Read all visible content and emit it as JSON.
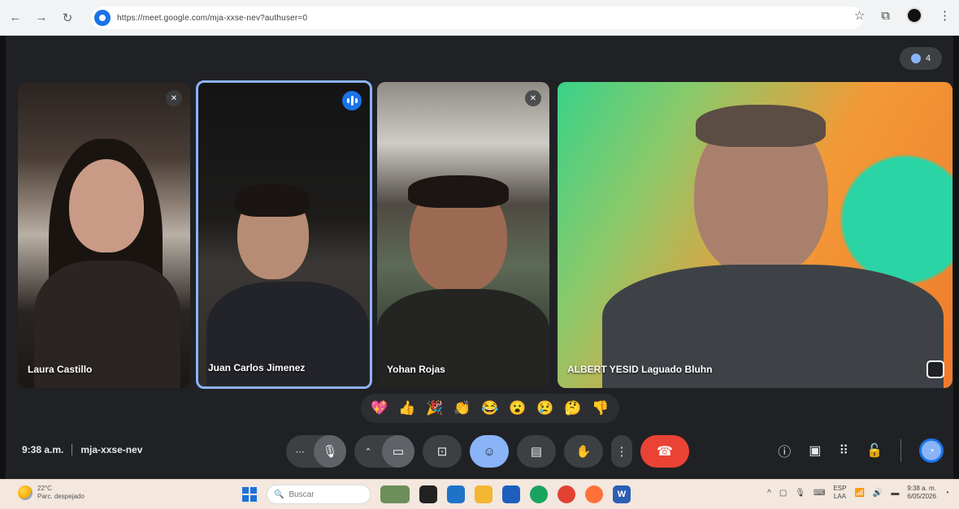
{
  "browser": {
    "url": "https://meet.google.com/mja-xxse-nev?authuser=0"
  },
  "meet": {
    "time": "9:38 a.m.",
    "meeting_code": "mja-xxse-nev",
    "participant_count": "4",
    "participants": [
      {
        "name": "Laura Castillo",
        "muted": true
      },
      {
        "name": "Juan Carlos Jimenez",
        "speaking": true
      },
      {
        "name": "Yohan Rojas",
        "muted": true
      },
      {
        "name": "ALBERT YESID Laguado Bluhn"
      }
    ],
    "reactions": [
      "💖",
      "👍",
      "🎉",
      "👏",
      "😂",
      "😮",
      "😢",
      "🤔",
      "👎"
    ]
  },
  "taskbar": {
    "weather_temp": "22°C",
    "weather_desc": "Parc. despejado",
    "search_placeholder": "Buscar",
    "lang_line1": "ESP",
    "lang_line2": "LAA",
    "clock_time": "9:38 a. m.",
    "clock_date": "6/05/2026"
  },
  "colors": {
    "meet_bg": "#202124",
    "active_blue": "#8ab4f8",
    "hangup_red": "#ea4335"
  }
}
